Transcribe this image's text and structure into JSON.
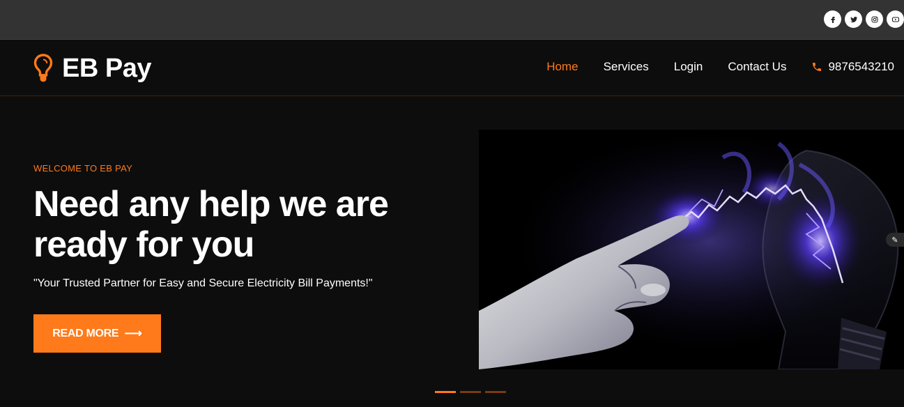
{
  "social": [
    {
      "name": "facebook",
      "glyph": "f"
    },
    {
      "name": "twitter",
      "glyph": "t"
    },
    {
      "name": "instagram",
      "glyph": "i"
    },
    {
      "name": "youtube",
      "glyph": "y"
    }
  ],
  "brand": {
    "name": "EB Pay",
    "icon": "lightbulb-icon",
    "accent": "#ff7a1a"
  },
  "nav": {
    "items": [
      {
        "label": "Home",
        "active": true
      },
      {
        "label": "Services",
        "active": false
      },
      {
        "label": "Login",
        "active": false
      },
      {
        "label": "Contact Us",
        "active": false
      }
    ],
    "phone": "9876543210"
  },
  "hero": {
    "eyebrow": "WELCOME TO EB PAY",
    "headline_line1": "Need any help we are",
    "headline_line2": "ready for you",
    "tagline": "\"Your Trusted Partner for Easy and Secure Electricity Bill Payments!\"",
    "button_label": "READ MORE",
    "button_icon": "arrow-right-icon",
    "image": "hand-touching-glowing-lightbulb"
  },
  "slider": {
    "count": 3,
    "active_index": 0
  }
}
